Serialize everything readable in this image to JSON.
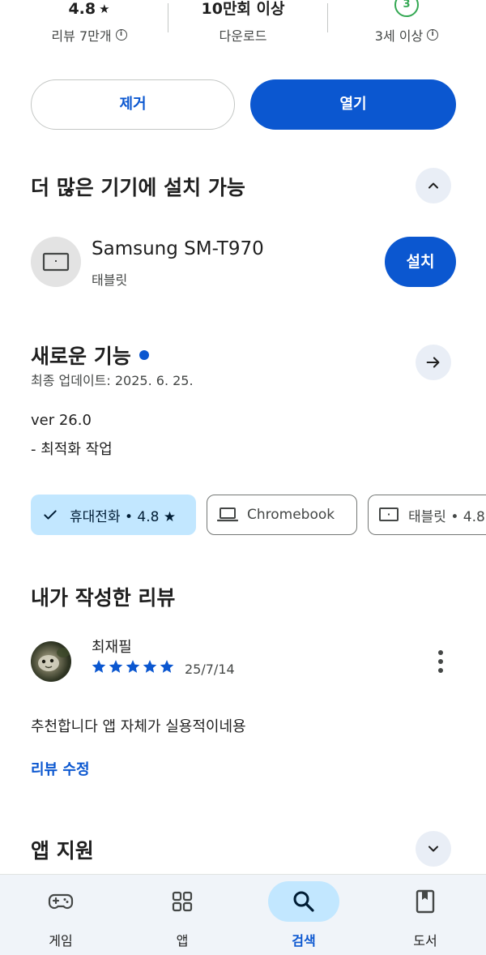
{
  "stats": {
    "rating": "4.8",
    "rating_star": "★",
    "reviews_label": "리뷰 7만개",
    "downloads": "10만회 이상",
    "downloads_label": "다운로드",
    "age_rating": "3",
    "age_label": "3세 이상",
    "info_glyph": "i"
  },
  "actions": {
    "remove_label": "제거",
    "open_label": "열기"
  },
  "more_devices": {
    "title": "더 많은 기기에 설치 가능",
    "collapse_icon": "chevron-up-icon",
    "device_name": "Samsung SM-T970",
    "device_type": "태블릿",
    "install_label": "설치"
  },
  "whats_new": {
    "title": "새로운 기능",
    "updated": "최종 업데이트: 2025. 6. 25.",
    "version": "ver 26.0",
    "notes": "- 최적화 작업",
    "arrow_icon": "arrow-right-icon"
  },
  "device_chips": [
    {
      "label": "휴대전화 • 4.8 ★",
      "selected": true,
      "icon": "check-icon"
    },
    {
      "label": "Chromebook",
      "selected": false,
      "icon": "laptop-icon"
    },
    {
      "label": "태블릿 • 4.8",
      "selected": false,
      "icon": "tablet-icon"
    }
  ],
  "my_review": {
    "title": "내가 작성한 리뷰",
    "reviewer": "최재필",
    "stars": 5,
    "date": "25/7/14",
    "text": "추천합니다 앱 자체가 실용적이네용",
    "edit_label": "리뷰 수정"
  },
  "app_support": {
    "title": "앱 지원",
    "expand_icon": "chevron-down-icon"
  },
  "bottom_nav": [
    {
      "label": "게임",
      "icon": "gamepad-icon",
      "active": false
    },
    {
      "label": "앱",
      "icon": "apps-grid-icon",
      "active": false
    },
    {
      "label": "검색",
      "icon": "search-icon",
      "active": true
    },
    {
      "label": "도서",
      "icon": "book-icon",
      "active": false
    }
  ],
  "colors": {
    "accent": "#0b57d0",
    "chip_selected": "#c2e7ff",
    "age_green": "#34a853"
  }
}
